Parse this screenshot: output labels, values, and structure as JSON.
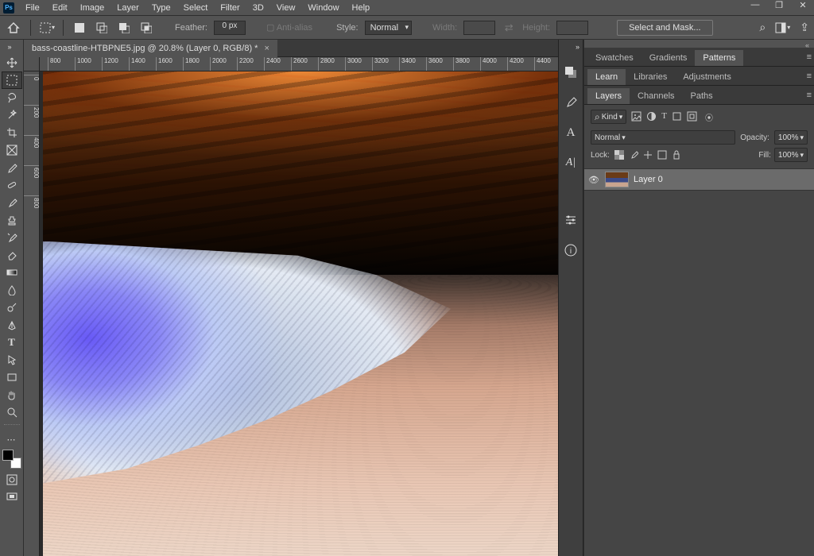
{
  "menu": {
    "items": [
      "File",
      "Edit",
      "Image",
      "Layer",
      "Type",
      "Select",
      "Filter",
      "3D",
      "View",
      "Window",
      "Help"
    ]
  },
  "options": {
    "feather_label": "Feather:",
    "feather_value": "0 px",
    "antialias_label": "Anti-alias",
    "style_label": "Style:",
    "style_value": "Normal",
    "width_label": "Width:",
    "height_label": "Height:",
    "mask_button": "Select and Mask..."
  },
  "doc": {
    "tab_title": "bass-coastline-HTBPNE5.jpg @ 20.8% (Layer 0, RGB/8) *"
  },
  "ruler": {
    "h_marks": [
      "800",
      "1000",
      "1200",
      "1400",
      "1600",
      "1800",
      "2000",
      "2200",
      "2400",
      "2600",
      "2800",
      "3000",
      "3200",
      "3400",
      "3600",
      "3800",
      "4000",
      "4200",
      "4400"
    ],
    "v_marks": [
      "0",
      "200",
      "400",
      "600",
      "800"
    ]
  },
  "panels": {
    "group1": {
      "tabs": [
        "Swatches",
        "Gradients",
        "Patterns"
      ],
      "active": "Patterns"
    },
    "group2": {
      "tabs": [
        "Learn",
        "Libraries",
        "Adjustments"
      ],
      "active": "Learn"
    },
    "group3": {
      "tabs": [
        "Layers",
        "Channels",
        "Paths"
      ],
      "active": "Layers"
    }
  },
  "layers_panel": {
    "kind_label": "Kind",
    "blend_mode": "Normal",
    "opacity_label": "Opacity:",
    "opacity_value": "100%",
    "lock_label": "Lock:",
    "fill_label": "Fill:",
    "fill_value": "100%",
    "layer0_name": "Layer 0"
  }
}
